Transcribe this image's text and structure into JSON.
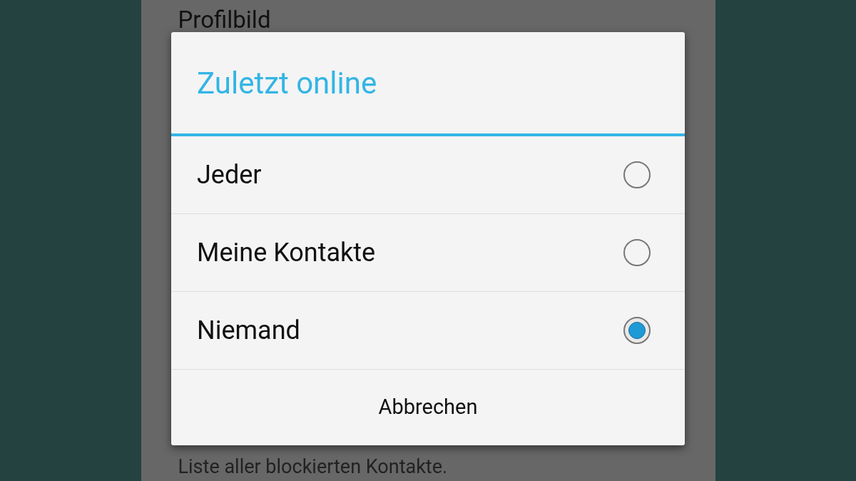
{
  "background": {
    "top_item": "Profilbild",
    "bottom_item": "Liste aller blockierten Kontakte."
  },
  "dialog": {
    "title": "Zuletzt online",
    "options": [
      {
        "label": "Jeder",
        "selected": false
      },
      {
        "label": "Meine Kontakte",
        "selected": false
      },
      {
        "label": "Niemand",
        "selected": true
      }
    ],
    "cancel": "Abbrechen"
  }
}
